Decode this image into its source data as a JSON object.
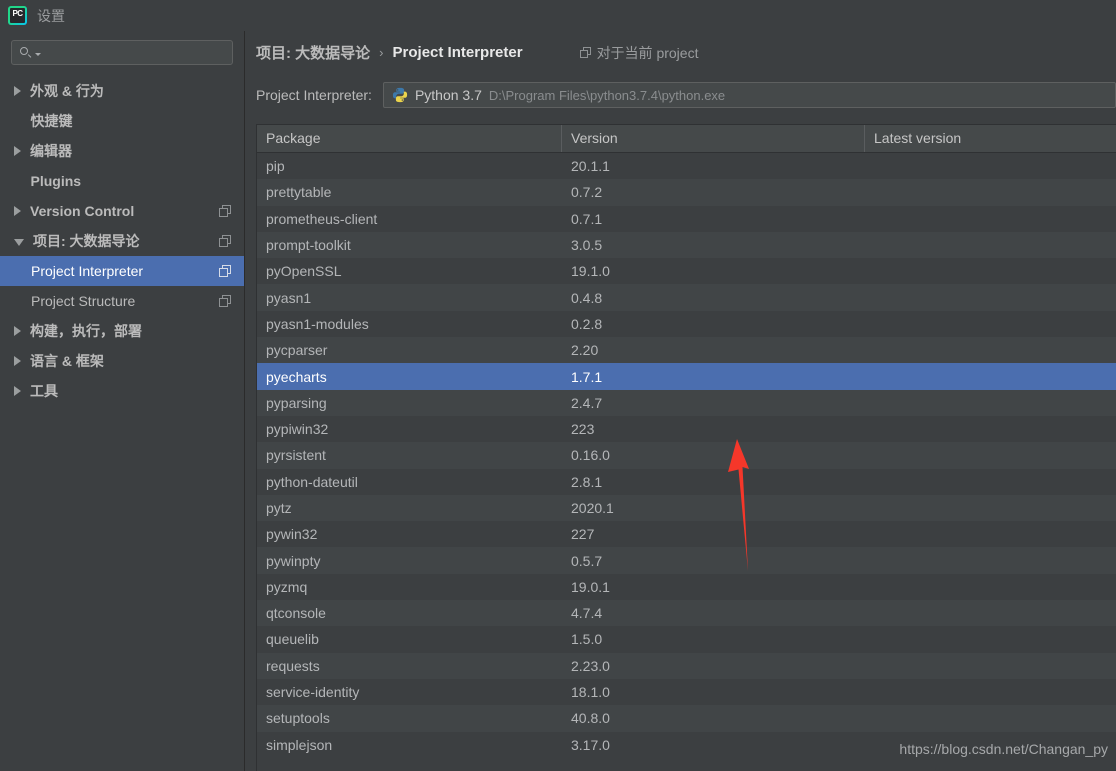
{
  "window": {
    "title": "设置",
    "app_icon": "pycharm-icon",
    "icon_text": "PC"
  },
  "sidebar": {
    "search": {
      "placeholder": "",
      "value": "",
      "icon": "search-icon",
      "dropdown_icon": "chevron-down-icon"
    },
    "items": [
      {
        "label": "外观 & 行为",
        "expander": "right",
        "bold": true,
        "child": false,
        "copy": false,
        "selected": false
      },
      {
        "label": "快捷键",
        "expander": "none",
        "bold": true,
        "child": false,
        "copy": false,
        "selected": false
      },
      {
        "label": "编辑器",
        "expander": "right",
        "bold": true,
        "child": false,
        "copy": false,
        "selected": false
      },
      {
        "label": "Plugins",
        "expander": "none",
        "bold": true,
        "child": false,
        "copy": false,
        "selected": false
      },
      {
        "label": "Version Control",
        "expander": "right",
        "bold": true,
        "child": false,
        "copy": true,
        "selected": false
      },
      {
        "label": "项目: 大数据导论",
        "expander": "down",
        "bold": true,
        "child": false,
        "copy": true,
        "selected": false
      },
      {
        "label": "Project Interpreter",
        "expander": "none",
        "bold": false,
        "child": true,
        "copy": true,
        "selected": true
      },
      {
        "label": "Project Structure",
        "expander": "none",
        "bold": false,
        "child": true,
        "copy": true,
        "selected": false
      },
      {
        "label": "构建，执行，部署",
        "expander": "right",
        "bold": true,
        "child": false,
        "copy": false,
        "selected": false
      },
      {
        "label": "语言 & 框架",
        "expander": "right",
        "bold": true,
        "child": false,
        "copy": false,
        "selected": false
      },
      {
        "label": "工具",
        "expander": "right",
        "bold": true,
        "child": false,
        "copy": false,
        "selected": false
      }
    ]
  },
  "main": {
    "breadcrumb": {
      "project": "项目: 大数据导论",
      "separator": "›",
      "page": "Project Interpreter",
      "scope_hint": "对于当前 project",
      "scope_icon": "copy-icon"
    },
    "interpreter": {
      "label": "Project Interpreter:",
      "icon": "python-logo-icon",
      "name": "Python 3.7",
      "path": "D:\\Program Files\\python3.7.4\\python.exe"
    },
    "packages_table": {
      "columns": [
        "Package",
        "Version",
        "Latest version"
      ],
      "rows": [
        {
          "package": "pip",
          "version": "20.1.1",
          "latest": ""
        },
        {
          "package": "prettytable",
          "version": "0.7.2",
          "latest": ""
        },
        {
          "package": "prometheus-client",
          "version": "0.7.1",
          "latest": ""
        },
        {
          "package": "prompt-toolkit",
          "version": "3.0.5",
          "latest": ""
        },
        {
          "package": "pyOpenSSL",
          "version": "19.1.0",
          "latest": ""
        },
        {
          "package": "pyasn1",
          "version": "0.4.8",
          "latest": ""
        },
        {
          "package": "pyasn1-modules",
          "version": "0.2.8",
          "latest": ""
        },
        {
          "package": "pycparser",
          "version": "2.20",
          "latest": ""
        },
        {
          "package": "pyecharts",
          "version": "1.7.1",
          "latest": "",
          "selected": true
        },
        {
          "package": "pyparsing",
          "version": "2.4.7",
          "latest": ""
        },
        {
          "package": "pypiwin32",
          "version": "223",
          "latest": ""
        },
        {
          "package": "pyrsistent",
          "version": "0.16.0",
          "latest": ""
        },
        {
          "package": "python-dateutil",
          "version": "2.8.1",
          "latest": ""
        },
        {
          "package": "pytz",
          "version": "2020.1",
          "latest": ""
        },
        {
          "package": "pywin32",
          "version": "227",
          "latest": ""
        },
        {
          "package": "pywinpty",
          "version": "0.5.7",
          "latest": ""
        },
        {
          "package": "pyzmq",
          "version": "19.0.1",
          "latest": ""
        },
        {
          "package": "qtconsole",
          "version": "4.7.4",
          "latest": ""
        },
        {
          "package": "queuelib",
          "version": "1.5.0",
          "latest": ""
        },
        {
          "package": "requests",
          "version": "2.23.0",
          "latest": ""
        },
        {
          "package": "service-identity",
          "version": "18.1.0",
          "latest": ""
        },
        {
          "package": "setuptools",
          "version": "40.8.0",
          "latest": ""
        },
        {
          "package": "simplejson",
          "version": "3.17.0",
          "latest": ""
        }
      ]
    }
  },
  "annotation": {
    "arrow_color": "#f5372a",
    "arrow_name": "red-arrow-annotation"
  },
  "watermark": {
    "text": "https://blog.csdn.net/Changan_py"
  },
  "colors": {
    "background": "#3c3f41",
    "selection": "#4b6eaf",
    "row_alt": "#414547",
    "header": "#45494a",
    "text": "#bbbbbb"
  }
}
